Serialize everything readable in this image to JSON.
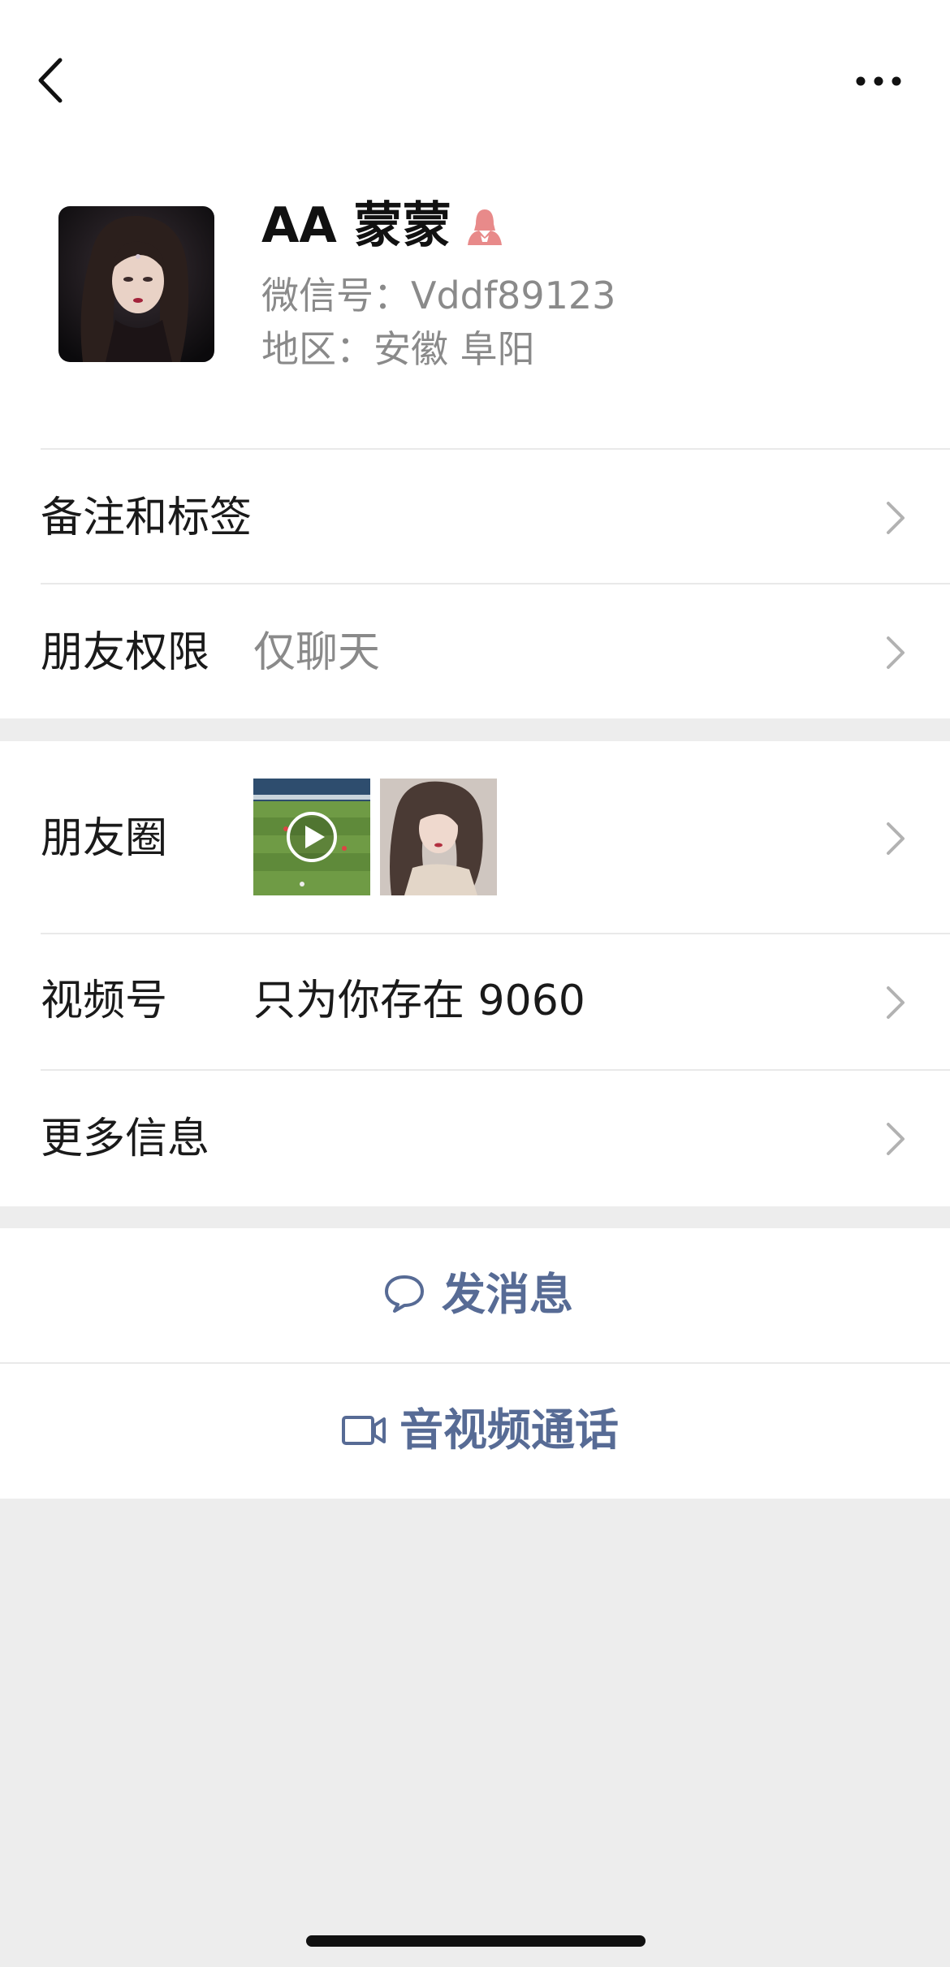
{
  "profile": {
    "name": "AA 蒙蒙",
    "wechat_id_line": "微信号：Vddf89123",
    "region_line": "地区：安徽 阜阳",
    "gender_icon": "female-icon",
    "gender_color": "#e88a8a"
  },
  "rows": {
    "remarks": {
      "label": "备注和标签"
    },
    "permissions": {
      "label": "朋友权限",
      "value": "仅聊天"
    },
    "moments": {
      "label": "朋友圈"
    },
    "channels": {
      "label": "视频号",
      "value": "只为你存在 9060"
    },
    "more_info": {
      "label": "更多信息"
    }
  },
  "actions": {
    "message": {
      "label": "发消息",
      "icon": "chat-bubble-icon"
    },
    "call": {
      "label": "音视频通话",
      "icon": "video-camera-icon"
    }
  },
  "colors": {
    "accent": "#576b95",
    "background": "#ededed",
    "card": "#ffffff",
    "secondary_text": "#8a8a8a"
  }
}
